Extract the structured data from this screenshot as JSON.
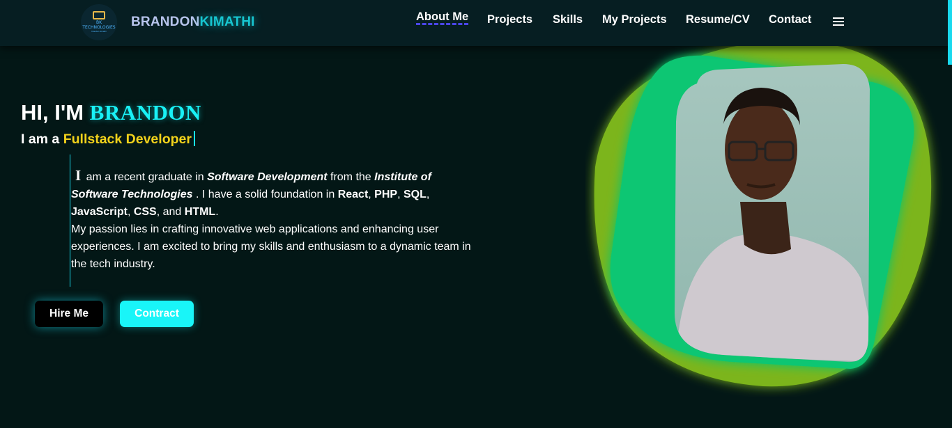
{
  "header": {
    "logo": {
      "line1": "BK",
      "line2": "TECHNOLOGIES",
      "line3": "brandon kimathi"
    },
    "brand_first": "BRANDON",
    "brand_last": "KIMATHI"
  },
  "nav": {
    "items": [
      {
        "label": "About Me",
        "active": true
      },
      {
        "label": "Projects"
      },
      {
        "label": "Skills"
      },
      {
        "label": "My Projects"
      },
      {
        "label": "Resume/CV"
      },
      {
        "label": "Contact"
      }
    ],
    "menu_icon": "hamburger-menu-icon"
  },
  "hero": {
    "greeting_prefix": "HI, I'M ",
    "greeting_name": "BRANDON",
    "role_prefix": "I am a ",
    "role_title": "Fullstack Developer",
    "about": {
      "dropcap": "I",
      "t1": " am a recent graduate in ",
      "b1": "Software Development",
      "t2": " from the ",
      "b2": "Institute of Software Technologies",
      "t3": " . I have a solid foundation in ",
      "s1": "React",
      "c1": ", ",
      "s2": "PHP",
      "c2": ", ",
      "s3": "SQL",
      "c3": ", ",
      "s4": "JavaScript",
      "c4": ", ",
      "s5": "CSS",
      "c5": ", and ",
      "s6": "HTML",
      "end": ".",
      "paragraph2": "My passion lies in crafting innovative web applications and enhancing user experiences. I am excited to bring my skills and enthusiasm to a dynamic team in the tech industry."
    },
    "buttons": {
      "hire": "Hire Me",
      "contract": "Contract"
    }
  },
  "colors": {
    "background": "#031716",
    "accent_cyan": "#19f1f6",
    "accent_yellow": "#f2d21b",
    "blob_green": "#0cc673",
    "blob_olive": "#7bb51b"
  }
}
